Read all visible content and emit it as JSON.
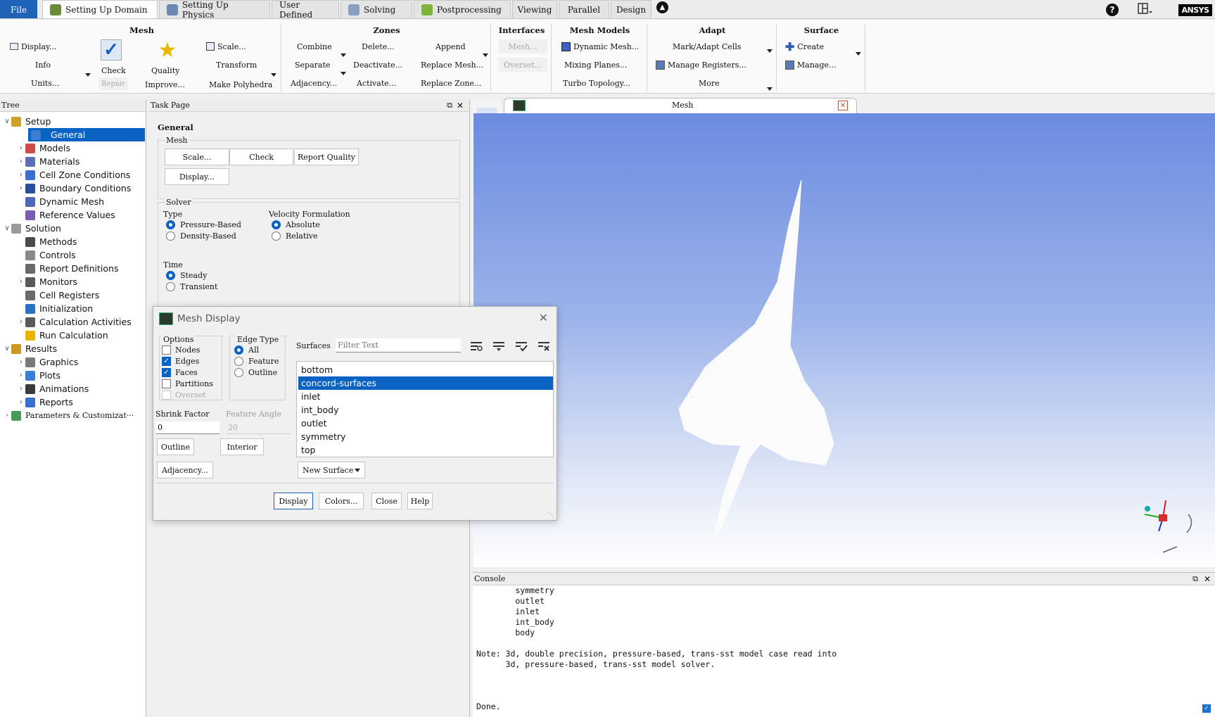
{
  "tabs": [
    {
      "label": "File",
      "kind": "file"
    },
    {
      "label": "Setting Up Domain",
      "kind": "active"
    },
    {
      "label": "Setting Up Physics"
    },
    {
      "label": "User Defined"
    },
    {
      "label": "Solving"
    },
    {
      "label": "Postprocessing"
    },
    {
      "label": "Viewing"
    },
    {
      "label": "Parallel"
    },
    {
      "label": "Design"
    }
  ],
  "brand": "ANSYS",
  "help_symbol": "?",
  "ribbon": {
    "mesh": {
      "title": "Mesh",
      "display": "Display...",
      "info": "Info",
      "units": "Units...",
      "check": "Check",
      "repair": "Repair",
      "quality": "Quality",
      "improve": "Improve...",
      "scale": "Scale...",
      "transform": "Transform",
      "make_polyhedra": "Make Polyhedra"
    },
    "zones": {
      "title": "Zones",
      "combine": "Combine",
      "separate": "Separate",
      "adjacency": "Adjacency...",
      "delete": "Delete...",
      "deactivate": "Deactivate...",
      "activate": "Activate...",
      "append": "Append",
      "replace_mesh": "Replace Mesh...",
      "replace_zone": "Replace Zone..."
    },
    "interfaces": {
      "title": "Interfaces",
      "mesh": "Mesh...",
      "overset": "Overset..."
    },
    "mesh_models": {
      "title": "Mesh Models",
      "dynamic_mesh": "Dynamic Mesh...",
      "mixing_planes": "Mixing Planes...",
      "turbo_topology": "Turbo Topology..."
    },
    "adapt": {
      "title": "Adapt",
      "mark_adapt": "Mark/Adapt Cells",
      "manage_registers": "Manage Registers...",
      "more": "More"
    },
    "surface": {
      "title": "Surface",
      "create": "Create",
      "manage": "Manage..."
    }
  },
  "tree": {
    "title": "Tree",
    "items": [
      {
        "label": "Setup",
        "level": 0,
        "chev": "v",
        "color": "#c9a227"
      },
      {
        "label": "General",
        "level": 1,
        "chev": "",
        "color": "#3b7fd1",
        "selected": true
      },
      {
        "label": "Models",
        "level": 1,
        "chev": ">",
        "color": "#d04a4a"
      },
      {
        "label": "Materials",
        "level": 1,
        "chev": ">",
        "color": "#5a6fb5"
      },
      {
        "label": "Cell Zone Conditions",
        "level": 1,
        "chev": ">",
        "color": "#3a6fd0"
      },
      {
        "label": "Boundary Conditions",
        "level": 1,
        "chev": ">",
        "color": "#2c4f9c"
      },
      {
        "label": "Dynamic Mesh",
        "level": 1,
        "chev": "",
        "color": "#4b69b8"
      },
      {
        "label": "Reference Values",
        "level": 1,
        "chev": "",
        "color": "#7a5db0"
      },
      {
        "label": "Solution",
        "level": 0,
        "chev": "v",
        "color": "#9a9a9a"
      },
      {
        "label": "Methods",
        "level": 1,
        "chev": "",
        "color": "#4a4a4a"
      },
      {
        "label": "Controls",
        "level": 1,
        "chev": "",
        "color": "#8a8a8a"
      },
      {
        "label": "Report Definitions",
        "level": 1,
        "chev": "",
        "color": "#6a6a6a"
      },
      {
        "label": "Monitors",
        "level": 1,
        "chev": ">",
        "color": "#5a5a5a"
      },
      {
        "label": "Cell Registers",
        "level": 1,
        "chev": "",
        "color": "#6a6a6a"
      },
      {
        "label": "Initialization",
        "level": 1,
        "chev": "",
        "color": "#2a6fc2"
      },
      {
        "label": "Calculation Activities",
        "level": 1,
        "chev": ">",
        "color": "#5a5a5a"
      },
      {
        "label": "Run Calculation",
        "level": 1,
        "chev": "",
        "color": "#e6b400"
      },
      {
        "label": "Results",
        "level": 0,
        "chev": "v",
        "color": "#c99a20"
      },
      {
        "label": "Graphics",
        "level": 1,
        "chev": ">",
        "color": "#7a7a7a"
      },
      {
        "label": "Plots",
        "level": 1,
        "chev": ">",
        "color": "#3a7fd1"
      },
      {
        "label": "Animations",
        "level": 1,
        "chev": ">",
        "color": "#3a3a3a"
      },
      {
        "label": "Reports",
        "level": 1,
        "chev": ">",
        "color": "#3a6fd0"
      },
      {
        "label": "Parameters & Customizat···",
        "level": 0,
        "chev": ">",
        "color": "#4a9a5a",
        "serif": true
      }
    ]
  },
  "task": {
    "title": "Task Page",
    "heading": "General",
    "mesh_label": "Mesh",
    "scale": "Scale...",
    "check": "Check",
    "report_quality": "Report Quality",
    "display": "Display...",
    "solver_label": "Solver",
    "type_label": "Type",
    "pressure_based": "Pressure-Based",
    "density_based": "Density-Based",
    "velocity_label": "Velocity Formulation",
    "absolute": "Absolute",
    "relative": "Relative",
    "time_label": "Time",
    "steady": "Steady",
    "transient": "Transient"
  },
  "graphics": {
    "tab_title": "Mesh"
  },
  "console": {
    "title": "Console",
    "text": "        symmetry\n        outlet\n        inlet\n        int_body\n        body\n\nNote: 3d, double precision, pressure-based, trans-sst model case read into\n      3d, pressure-based, trans-sst model solver.\n\n\n\nDone."
  },
  "dialog": {
    "title": "Mesh Display",
    "options_label": "Options",
    "nodes": "Nodes",
    "edges": "Edges",
    "faces": "Faces",
    "partitions": "Partitions",
    "overset": "Overset",
    "edge_type_label": "Edge Type",
    "all": "All",
    "feature": "Feature",
    "outline": "Outline",
    "surfaces_label": "Surfaces",
    "filter_placeholder": "Filter Text",
    "shrink_label": "Shrink Factor",
    "shrink_value": "0",
    "feature_angle_label": "Feature Angle",
    "feature_angle_value": "20",
    "outline_btn": "Outline",
    "interior_btn": "Interior",
    "adjacency_btn": "Adjacency...",
    "new_surface": "New Surface",
    "surfaces": [
      "bottom",
      "concord-surfaces",
      "inlet",
      "int_body",
      "outlet",
      "symmetry",
      "top"
    ],
    "selected_surface": "concord-surfaces",
    "display_btn": "Display",
    "colors_btn": "Colors...",
    "close_btn": "Close",
    "help_btn": "Help"
  }
}
